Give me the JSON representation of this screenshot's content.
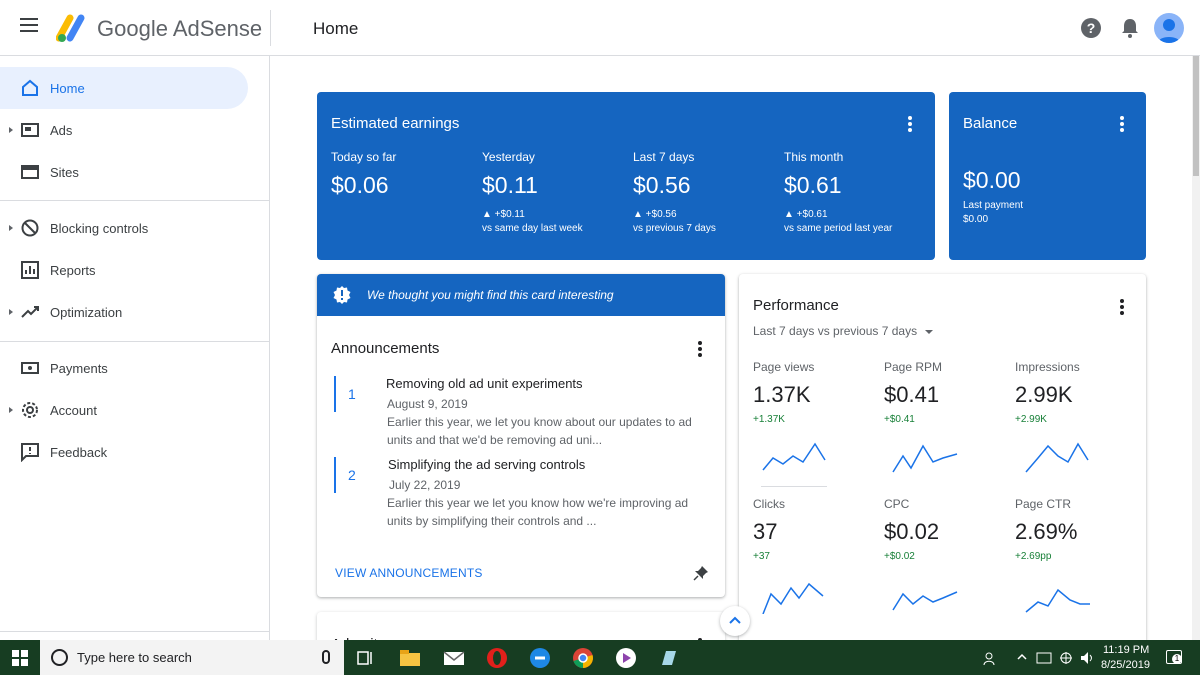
{
  "app": {
    "brand": "Google AdSense",
    "page_title": "Home"
  },
  "header_icons": [
    "menu-icon",
    "help-icon",
    "notifications-icon",
    "account-avatar"
  ],
  "sidebar": {
    "items": [
      {
        "label": "Home",
        "icon": "home-icon",
        "active": true
      },
      {
        "label": "Ads",
        "icon": "ads-icon",
        "expandable": true
      },
      {
        "label": "Sites",
        "icon": "sites-icon"
      },
      {
        "label": "Blocking controls",
        "icon": "block-icon",
        "expandable": true
      },
      {
        "label": "Reports",
        "icon": "reports-icon"
      },
      {
        "label": "Optimization",
        "icon": "optimization-icon",
        "expandable": true
      },
      {
        "label": "Payments",
        "icon": "payments-icon"
      },
      {
        "label": "Account",
        "icon": "gear-icon",
        "expandable": true
      },
      {
        "label": "Feedback",
        "icon": "feedback-icon"
      }
    ]
  },
  "earnings": {
    "title": "Estimated earnings",
    "metrics": [
      {
        "label": "Today so far",
        "value": "$0.06",
        "delta": "",
        "compare": ""
      },
      {
        "label": "Yesterday",
        "value": "$0.11",
        "delta": "▲ +$0.11",
        "compare": "vs same day last week"
      },
      {
        "label": "Last 7 days",
        "value": "$0.56",
        "delta": "▲ +$0.56",
        "compare": "vs previous 7 days"
      },
      {
        "label": "This month",
        "value": "$0.61",
        "delta": "▲ +$0.61",
        "compare": "vs same period last year"
      }
    ]
  },
  "balance": {
    "title": "Balance",
    "value": "$0.00",
    "last_payment_label": "Last payment",
    "last_payment_value": "$0.00"
  },
  "announcements": {
    "hint": "We thought you might find this card interesting",
    "title": "Announcements",
    "items": [
      {
        "number": "1",
        "heading": "Removing old ad unit experiments",
        "date": "August 9, 2019",
        "body": "Earlier this year, we let you know about our updates to ad units and that we'd be removing ad uni..."
      },
      {
        "number": "2",
        "heading": "Simplifying the ad serving controls",
        "date": "July 22, 2019",
        "body": "Earlier this year we let you know how we're improving ad units by simplifying their controls and ..."
      }
    ],
    "view_all": "VIEW ANNOUNCEMENTS"
  },
  "next_card_title": "Ad units",
  "performance": {
    "title": "Performance",
    "range": "Last 7 days vs previous 7 days",
    "metrics": [
      {
        "label": "Page views",
        "value": "1.37K",
        "delta": "+1.37K"
      },
      {
        "label": "Page RPM",
        "value": "$0.41",
        "delta": "+$0.41"
      },
      {
        "label": "Impressions",
        "value": "2.99K",
        "delta": "+2.99K"
      },
      {
        "label": "Clicks",
        "value": "37",
        "delta": "+37"
      },
      {
        "label": "CPC",
        "value": "$0.02",
        "delta": "+$0.02"
      },
      {
        "label": "Page CTR",
        "value": "2.69%",
        "delta": "+2.69pp"
      }
    ]
  },
  "taskbar": {
    "search_placeholder": "Type here to search",
    "time": "11:19 PM",
    "date": "8/25/2019",
    "notification_count": "1"
  },
  "colors": {
    "card_blue": "#1565c0",
    "accent": "#1a73e8",
    "positive": "#188038"
  }
}
